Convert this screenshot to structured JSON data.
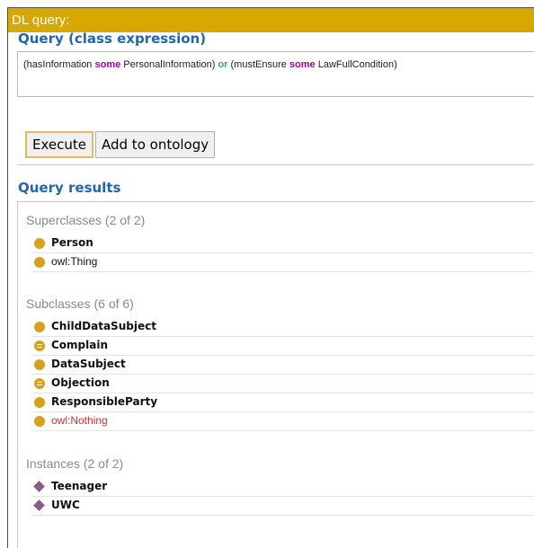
{
  "window": {
    "title": "DL query:"
  },
  "query": {
    "section_title": "Query (class expression)",
    "tokens": {
      "t1": "(hasInformation ",
      "t2": "some",
      "t3": " PersonalInformation) ",
      "t4": "or",
      "t5": " (mustEnsure ",
      "t6": "some",
      "t7": " LawFullCondition)"
    },
    "execute_label": "Execute",
    "add_label": "Add to ontology"
  },
  "results": {
    "section_title": "Query results",
    "superclasses": {
      "header": "Superclasses (2 of 2)",
      "items": [
        {
          "label": "Person",
          "icon": "class-icon"
        },
        {
          "label": "owl:Thing",
          "icon": "class-icon"
        }
      ]
    },
    "subclasses": {
      "header": "Subclasses (6 of 6)",
      "items": [
        {
          "label": "ChildDataSubject",
          "icon": "class-icon"
        },
        {
          "label": "Complain",
          "icon": "defined-class-icon"
        },
        {
          "label": "DataSubject",
          "icon": "class-icon"
        },
        {
          "label": "Objection",
          "icon": "defined-class-icon"
        },
        {
          "label": "ResponsibleParty",
          "icon": "class-icon"
        },
        {
          "label": "owl:Nothing",
          "icon": "class-icon"
        }
      ]
    },
    "instances": {
      "header": "Instances (2 of 2)",
      "items": [
        {
          "label": "Teenager",
          "icon": "individual-icon"
        },
        {
          "label": "UWC",
          "icon": "individual-icon"
        }
      ]
    }
  },
  "colors": {
    "title_bar": "#d9a800",
    "section_title": "#2266b0",
    "keyword_some": "#a200a2",
    "keyword_or": "#2aa0b0",
    "class_icon": "#d6a21c",
    "individual_icon": "#8a5a8a",
    "nothing_text": "#d03030"
  }
}
